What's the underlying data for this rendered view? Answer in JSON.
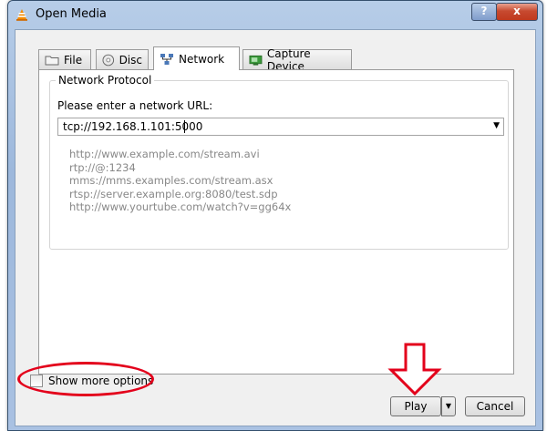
{
  "window": {
    "title": "Open Media",
    "help_glyph": "?",
    "close_glyph": "x"
  },
  "tabs": [
    {
      "label": "File",
      "icon": "folder-icon"
    },
    {
      "label": "Disc",
      "icon": "disc-icon"
    },
    {
      "label": "Network",
      "icon": "network-icon",
      "active": true
    },
    {
      "label": "Capture Device",
      "icon": "capture-device-icon"
    }
  ],
  "network": {
    "group_title": "Network Protocol",
    "url_label": "Please enter a network URL:",
    "url_value": "tcp://192.168.1.101:5000",
    "examples": [
      "http://www.example.com/stream.avi",
      "rtp://@:1234",
      "mms://mms.examples.com/stream.asx",
      "rtsp://server.example.org:8080/test.sdp",
      "http://www.yourtube.com/watch?v=gg64x"
    ]
  },
  "options": {
    "show_more_label": "Show more options",
    "checked": false
  },
  "footer": {
    "play_label": "Play",
    "cancel_label": "Cancel"
  },
  "colors": {
    "annotation_red": "#e3001b",
    "titlebar_blue": "#a9c1e2",
    "close_red": "#c74a30"
  }
}
